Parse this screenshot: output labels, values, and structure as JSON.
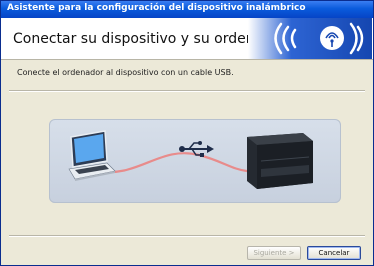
{
  "window": {
    "title": "Asistente para la configuración del dispositivo inalámbrico"
  },
  "header": {
    "title": "Conectar su dispositivo y su ordenador",
    "logo_icon": "wireless-logo-icon"
  },
  "content": {
    "instruction": "Conecte el ordenador al dispositivo con un cable USB.",
    "illustration": {
      "icons": [
        "laptop-icon",
        "usb-icon",
        "printer-icon"
      ],
      "cable_color": "#e88b8b"
    }
  },
  "buttons": {
    "next": "Siguiente >",
    "cancel": "Cancelar"
  },
  "colors": {
    "titlebar": "#0a5bdc",
    "accent": "#0b56c9"
  }
}
